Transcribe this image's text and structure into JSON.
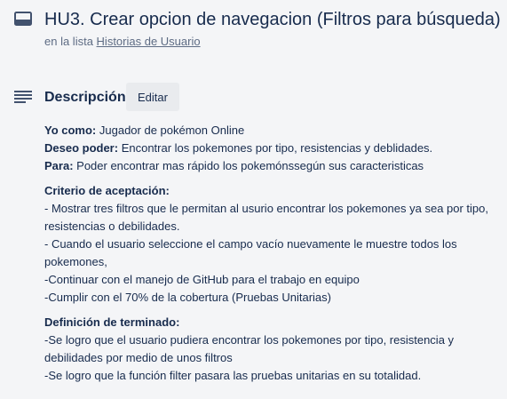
{
  "card": {
    "title": "HU3. Crear opcion de navegacion (Filtros para búsqueda)",
    "list_prefix": "en la lista ",
    "list_name": "Historias de Usuario"
  },
  "description": {
    "heading": "Descripción",
    "edit_label": "Editar",
    "intro": [
      {
        "label": "Yo como:",
        "text": " Jugador de pokémon Online"
      },
      {
        "label": "Deseo poder:",
        "text": " Encontrar los pokemones por tipo, resistencias y deblidades."
      },
      {
        "label": "Para:",
        "text": " Poder encontrar mas rápido los pokemónssegún sus caracteristicas"
      }
    ],
    "criteria_heading": "Criterio de aceptación:",
    "criteria": [
      "- Mostrar tres filtros que le permitan al usurio encontrar los pokemones ya sea por tipo, resistencias o debilidades.",
      "- Cuando el usuario seleccione el campo vacío nuevamente le muestre todos los pokemones,",
      "-Continuar con el manejo de GitHub para el trabajo en equipo",
      "-Cumplir con el 70% de la cobertura (Pruebas Unitarias)"
    ],
    "done_heading": "Definición de terminado:",
    "done": [
      "-Se logro que el usuario pudiera encontrar los pokemones por tipo, resistencia y debilidades por medio de unos filtros",
      "-Se logro que la función filter pasara las pruebas unitarias en su totalidad."
    ]
  },
  "icons": {
    "card": "card-icon",
    "description": "description-icon"
  }
}
